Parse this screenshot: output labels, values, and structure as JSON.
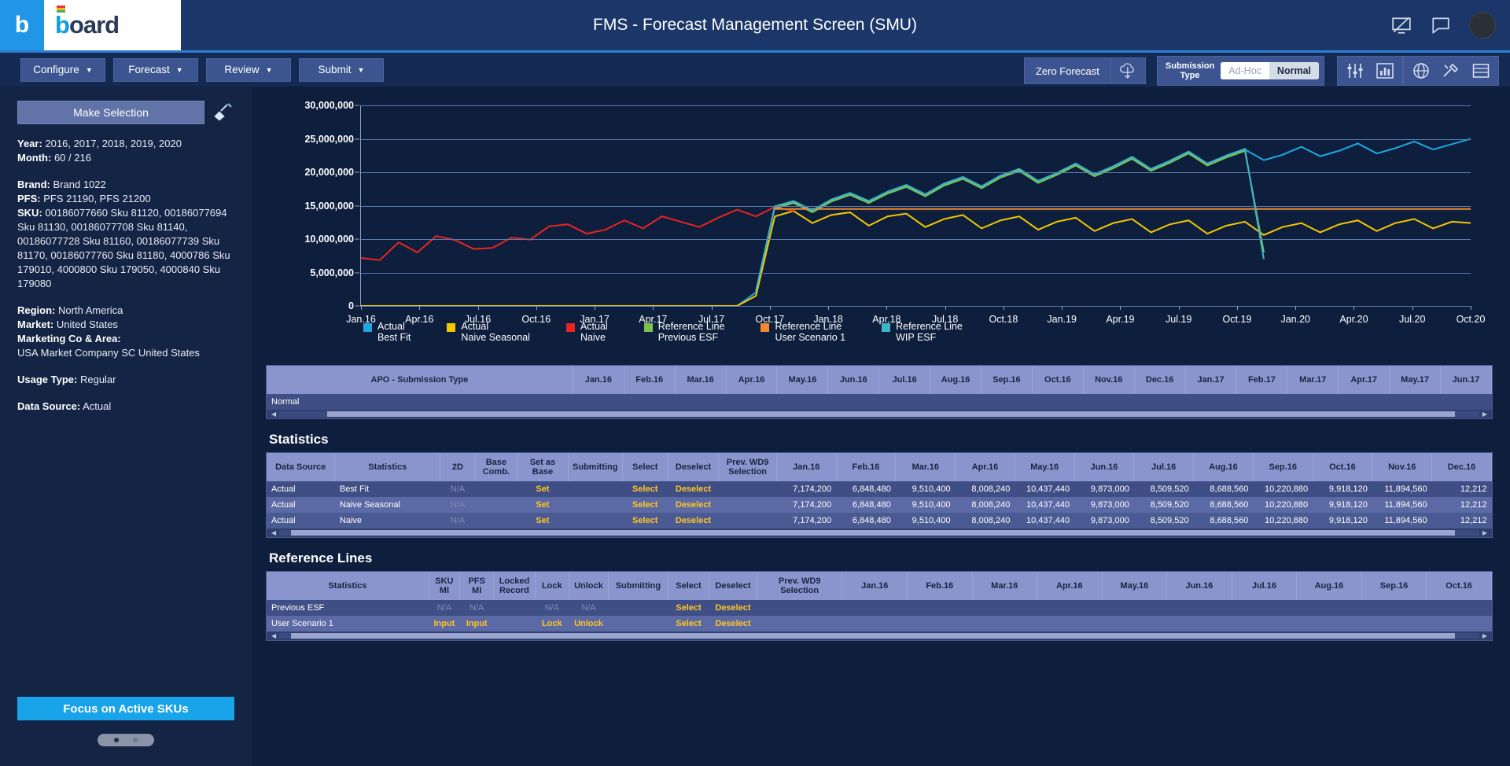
{
  "topbar": {
    "brand_glyph": "b",
    "brand_word_first": "b",
    "brand_word_rest": "oard",
    "title": "FMS - Forecast Management Screen (SMU)",
    "icons": [
      "screen-share-icon",
      "chat-icon",
      "avatar"
    ]
  },
  "menubar": {
    "buttons": [
      {
        "label": "Configure",
        "caret": "▼"
      },
      {
        "label": "Forecast",
        "caret": "▼"
      },
      {
        "label": "Review",
        "caret": "▼"
      },
      {
        "label": "Submit",
        "caret": "▼"
      }
    ],
    "zero_forecast": "Zero Forecast",
    "cloud_icon": "cloud-download-icon",
    "submission_type_label_line1": "Submission",
    "submission_type_label_line2": "Type",
    "submission_options": [
      "Ad-Hoc",
      "Normal"
    ],
    "submission_selected": "Normal",
    "right_icons": [
      "sliders-icon",
      "bar-chart-icon",
      "globe-icon",
      "tools-icon",
      "table-icon"
    ]
  },
  "sidebar": {
    "make_selection": "Make Selection",
    "broom_icon": "broom-icon",
    "fields": [
      {
        "label": "Year:",
        "value": "2016, 2017, 2018, 2019, 2020"
      },
      {
        "label": "Month:",
        "value": "60 / 216"
      }
    ],
    "fields2": [
      {
        "label": "Brand:",
        "value": "Brand 1022"
      },
      {
        "label": "PFS:",
        "value": "PFS 21190, PFS 21200"
      },
      {
        "label": "SKU:",
        "value": "00186077660 Sku 81120, 00186077694 Sku 81130, 00186077708 Sku 81140, 00186077728 Sku 81160, 00186077739 Sku 81170, 00186077760 Sku 81180, 4000786 Sku 179010, 4000800 Sku 179050, 4000840 Sku 179080"
      }
    ],
    "fields3": [
      {
        "label": "Region:",
        "value": "North America"
      },
      {
        "label": "Market:",
        "value": "United States"
      },
      {
        "label": "Marketing Co & Area:",
        "value": ""
      }
    ],
    "marketing_value": "USA Market Company SC United States",
    "fields4": [
      {
        "label": "Usage Type:",
        "value": "Regular"
      }
    ],
    "fields5": [
      {
        "label": "Data Source:",
        "value": "Actual"
      }
    ],
    "focus_button": "Focus on Active SKUs",
    "pager_dots": 2
  },
  "chart_data": {
    "type": "line",
    "title": "",
    "xlabel": "",
    "ylabel": "",
    "ylim": [
      0,
      30000000
    ],
    "yticks": [
      0,
      5000000,
      10000000,
      15000000,
      20000000,
      25000000,
      30000000
    ],
    "ytick_labels": [
      "0",
      "5,000,000",
      "10,000,000",
      "15,000,000",
      "20,000,000",
      "25,000,000",
      "30,000,000"
    ],
    "grid": true,
    "legend_position": "below",
    "xtick_labels": [
      "Jan.16",
      "Apr.16",
      "Jul.16",
      "Oct.16",
      "Jan.17",
      "Apr.17",
      "Jul.17",
      "Oct.17",
      "Jan.18",
      "Apr.18",
      "Jul.18",
      "Oct.18",
      "Jan.19",
      "Apr.19",
      "Jul.19",
      "Oct.19",
      "Jan.20",
      "Apr.20",
      "Jul.20",
      "Oct.20"
    ],
    "series": [
      {
        "name": "Actual Best Fit",
        "color": "#1fa8e0",
        "values": [
          0,
          0,
          0,
          0,
          0,
          0,
          0,
          0,
          0,
          0,
          0,
          0,
          0,
          0,
          0,
          0,
          0,
          0,
          0,
          0,
          0,
          2000000,
          14800000,
          15600000,
          14200000,
          15800000,
          16800000,
          15600000,
          17000000,
          18000000,
          16600000,
          18200000,
          19200000,
          17800000,
          19400000,
          20400000,
          18600000,
          19800000,
          21200000,
          19600000,
          20800000,
          22200000,
          20400000,
          21600000,
          23000000,
          21200000,
          22400000,
          23400000,
          21800000,
          22600000,
          23800000,
          22400000,
          23200000,
          24300000,
          22800000,
          23600000,
          24600000,
          23400000,
          24200000,
          25000000
        ]
      },
      {
        "name": "Actual Naive Seasonal",
        "color": "#f2c800",
        "values": [
          0,
          0,
          0,
          0,
          0,
          0,
          0,
          0,
          0,
          0,
          0,
          0,
          0,
          0,
          0,
          0,
          0,
          0,
          0,
          0,
          0,
          1500000,
          13400000,
          14200000,
          12400000,
          13600000,
          14000000,
          12000000,
          13400000,
          13800000,
          11800000,
          13000000,
          13600000,
          11600000,
          12800000,
          13400000,
          11400000,
          12600000,
          13200000,
          11200000,
          12400000,
          13000000,
          11000000,
          12200000,
          12800000,
          10800000,
          12000000,
          12600000,
          10600000,
          11800000,
          12400000,
          11000000,
          12200000,
          12800000,
          11200000,
          12400000,
          13000000,
          11600000,
          12600000,
          12400000
        ]
      },
      {
        "name": "Actual Naive",
        "color": "#e8241f",
        "values": [
          7174200,
          6848480,
          9510400,
          8008240,
          10437440,
          9873000,
          8509520,
          8688560,
          10220880,
          9918120,
          11894560,
          12212000,
          10800000,
          11400000,
          12800000,
          11600000,
          13400000,
          12600000,
          11800000,
          13200000,
          14400000,
          13400000,
          14800000,
          14200000,
          null,
          null,
          null,
          null,
          null,
          null,
          null,
          null,
          null,
          null,
          null,
          null,
          null,
          null,
          null,
          null,
          null,
          null,
          null,
          null,
          null,
          null,
          null,
          null,
          null,
          null,
          null,
          null,
          null,
          null,
          null,
          null,
          null,
          null,
          null,
          null
        ]
      },
      {
        "name": "Reference Line Previous ESF",
        "color": "#7ec24e",
        "values": [
          null,
          null,
          null,
          null,
          null,
          null,
          null,
          null,
          null,
          null,
          null,
          null,
          null,
          null,
          null,
          null,
          null,
          null,
          null,
          null,
          null,
          null,
          14600000,
          15400000,
          14000000,
          15600000,
          16600000,
          15400000,
          16800000,
          17800000,
          16400000,
          18000000,
          19000000,
          17600000,
          19200000,
          20200000,
          18400000,
          19600000,
          21000000,
          19400000,
          20600000,
          22000000,
          20200000,
          21400000,
          22800000,
          21000000,
          22200000,
          23200000,
          8000000,
          null,
          null,
          null,
          null,
          null,
          null,
          null,
          null,
          null,
          null,
          null
        ]
      },
      {
        "name": "Reference Line User Scenario 1",
        "color": "#f08a2c",
        "values": [
          null,
          null,
          null,
          null,
          null,
          null,
          null,
          null,
          null,
          null,
          null,
          null,
          null,
          null,
          null,
          null,
          null,
          null,
          null,
          null,
          null,
          null,
          14500000,
          14500000,
          14500000,
          14500000,
          14500000,
          14500000,
          14500000,
          14500000,
          14500000,
          14500000,
          14500000,
          14500000,
          14500000,
          14500000,
          14500000,
          14500000,
          14500000,
          14500000,
          14500000,
          14500000,
          14500000,
          14500000,
          14500000,
          14500000,
          14500000,
          14500000,
          14500000,
          14500000,
          14500000,
          14500000,
          14500000,
          14500000,
          14500000,
          14500000,
          14500000,
          14500000,
          14500000,
          14500000
        ]
      },
      {
        "name": "Reference Line WIP ESF",
        "color": "#3fb6c8",
        "values": [
          null,
          null,
          null,
          null,
          null,
          null,
          null,
          null,
          null,
          null,
          null,
          null,
          null,
          null,
          null,
          null,
          null,
          null,
          null,
          null,
          null,
          2200000,
          14900000,
          15700000,
          14300000,
          15900000,
          16900000,
          15700000,
          17100000,
          18100000,
          16700000,
          18300000,
          19300000,
          17900000,
          19500000,
          20500000,
          18700000,
          19900000,
          21300000,
          19700000,
          20900000,
          22300000,
          20500000,
          21700000,
          23100000,
          21300000,
          22500000,
          23500000,
          7000000,
          null,
          null,
          null,
          null,
          null,
          null,
          null,
          null,
          null,
          null,
          null
        ]
      }
    ],
    "legend": [
      {
        "line1": "Actual",
        "line2": "Best Fit",
        "color": "#1fa8e0"
      },
      {
        "line1": "Actual",
        "line2": "Naive Seasonal",
        "color": "#f2c800"
      },
      {
        "line1": "Actual",
        "line2": "Naive",
        "color": "#e8241f"
      },
      {
        "line1": "Reference Line",
        "line2": "Previous ESF",
        "color": "#7ec24e"
      },
      {
        "line1": "Reference Line",
        "line2": "User Scenario 1",
        "color": "#f08a2c"
      },
      {
        "line1": "Reference Line",
        "line2": "WIP ESF",
        "color": "#3fb6c8"
      }
    ]
  },
  "apo_panel": {
    "title": "APO - Submission Type",
    "months": [
      "Jan.16",
      "Feb.16",
      "Mar.16",
      "Apr.16",
      "May.16",
      "Jun.16",
      "Jul.16",
      "Aug.16",
      "Sep.16",
      "Oct.16",
      "Nov.16",
      "Dec.16",
      "Jan.17",
      "Feb.17",
      "Mar.17",
      "Apr.17",
      "May.17",
      "Jun.17"
    ],
    "row_label": "Normal"
  },
  "statistics": {
    "section_title": "Statistics",
    "headers": [
      "Data Source",
      "Statistics",
      "2D",
      "Base Comb.",
      "Set as Base",
      "Submitting",
      "Select",
      "Deselect",
      "Prev. WD9 Selection"
    ],
    "months": [
      "Jan.16",
      "Feb.16",
      "Mar.16",
      "Apr.16",
      "May.16",
      "Jun.16",
      "Jul.16",
      "Aug.16",
      "Sep.16",
      "Oct.16",
      "Nov.16",
      "Dec.16"
    ],
    "values": [
      "7,174,200",
      "6,848,480",
      "9,510,400",
      "8,008,240",
      "10,437,440",
      "9,873,000",
      "8,509,520",
      "8,688,560",
      "10,220,880",
      "9,918,120",
      "11,894,560",
      "12,212"
    ],
    "rows": [
      {
        "data_source": "Actual",
        "statistic": "Best Fit",
        "two_d": "N/A",
        "base_comb": "",
        "set_as_base": "Set",
        "submitting": "",
        "select": "Select",
        "deselect": "Deselect",
        "prev_wd9": ""
      },
      {
        "data_source": "Actual",
        "statistic": "Naive Seasonal",
        "two_d": "N/A",
        "base_comb": "",
        "set_as_base": "Set",
        "submitting": "",
        "select": "Select",
        "deselect": "Deselect",
        "prev_wd9": ""
      },
      {
        "data_source": "Actual",
        "statistic": "Naive",
        "two_d": "N/A",
        "base_comb": "",
        "set_as_base": "Set",
        "submitting": "",
        "select": "Select",
        "deselect": "Deselect",
        "prev_wd9": ""
      }
    ]
  },
  "reference_lines": {
    "section_title": "Reference Lines",
    "headers": [
      "Statistics",
      "SKU MI",
      "PFS MI",
      "Locked Record",
      "Lock",
      "Unlock",
      "Submitting",
      "Select",
      "Deselect",
      "Prev. WD9 Selection"
    ],
    "months": [
      "Jan.16",
      "Feb.16",
      "Mar.16",
      "Apr.16",
      "May.16",
      "Jun.16",
      "Jul.16",
      "Aug.16",
      "Sep.16",
      "Oct.16"
    ],
    "rows": [
      {
        "statistic": "Previous ESF",
        "sku_mi": "N/A",
        "pfs_mi": "N/A",
        "locked_record": "",
        "lock": "N/A",
        "unlock": "N/A",
        "submitting": "",
        "select": "Select",
        "deselect": "Deselect",
        "prev_wd9": ""
      },
      {
        "statistic": "User Scenario 1",
        "sku_mi": "Input",
        "pfs_mi": "Input",
        "locked_record": "",
        "lock": "Lock",
        "unlock": "Unlock",
        "submitting": "",
        "select": "Select",
        "deselect": "Deselect",
        "prev_wd9": ""
      }
    ]
  }
}
